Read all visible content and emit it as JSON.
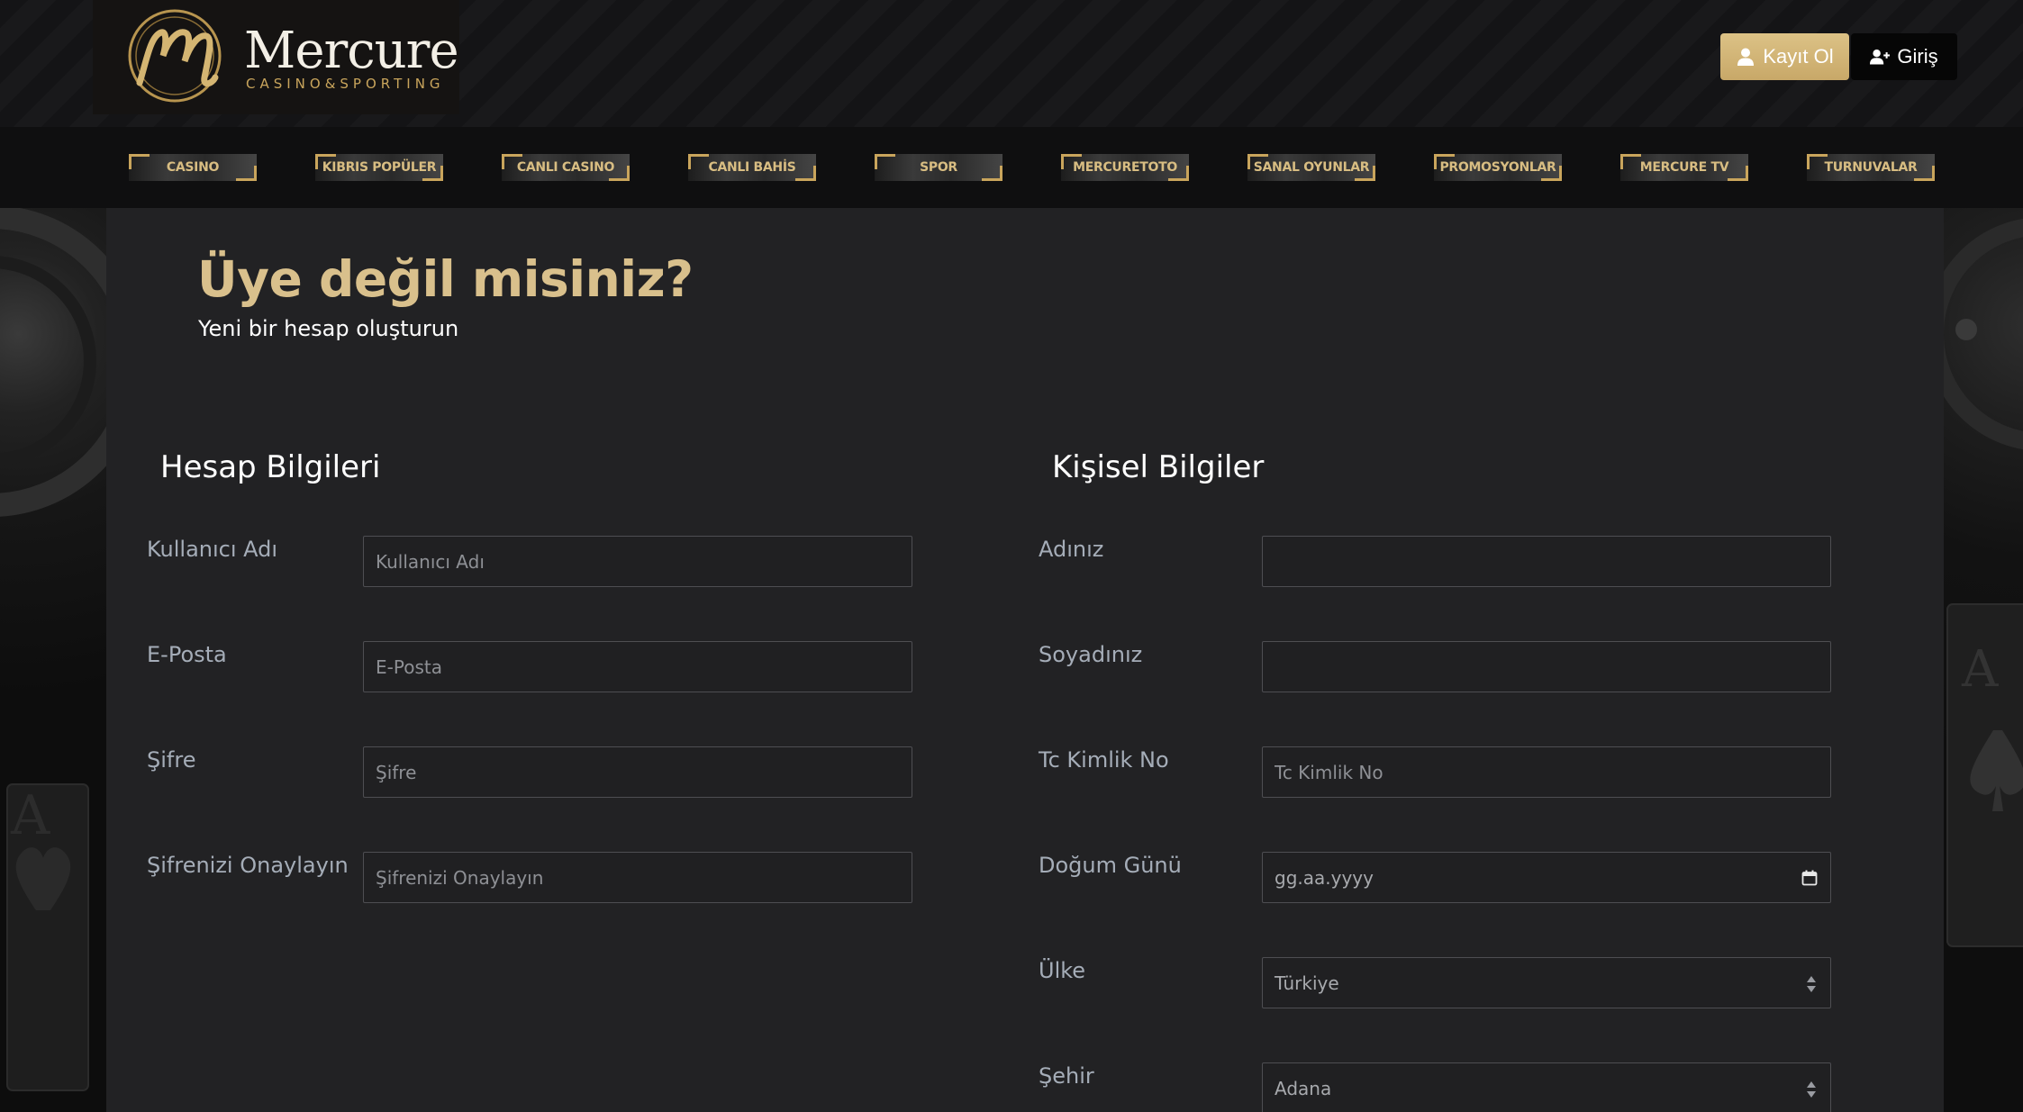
{
  "header": {
    "logo_text": "Mercure",
    "logo_subtext": "CASINO&SPORTING",
    "register_label": "Kayıt Ol",
    "login_label": "Giriş"
  },
  "nav": {
    "items": [
      {
        "label": "CASINO"
      },
      {
        "label": "KIBRIS POPÜLER"
      },
      {
        "label": "CANLI CASINO"
      },
      {
        "label": "CANLI BAHİS"
      },
      {
        "label": "SPOR"
      },
      {
        "label": "MERCURETOTO"
      },
      {
        "label": "SANAL OYUNLAR"
      },
      {
        "label": "PROMOSYONLAR"
      },
      {
        "label": "MERCURE TV"
      },
      {
        "label": "TURNUVALAR"
      }
    ]
  },
  "page": {
    "title": "Üye değil misiniz?",
    "subtitle": "Yeni bir hesap oluşturun"
  },
  "account": {
    "section_title": "Hesap Bilgileri",
    "fields": [
      {
        "label": "Kullanıcı Adı",
        "placeholder": "Kullanıcı Adı",
        "value": ""
      },
      {
        "label": "E-Posta",
        "placeholder": "E-Posta",
        "value": ""
      },
      {
        "label": "Şifre",
        "placeholder": "Şifre",
        "value": ""
      },
      {
        "label": "Şifrenizi Onaylayın",
        "placeholder": "Şifrenizi Onaylayın",
        "value": ""
      }
    ]
  },
  "personal": {
    "section_title": "Kişisel Bilgiler",
    "fields": [
      {
        "label": "Adınız",
        "placeholder": "",
        "value": ""
      },
      {
        "label": "Soyadınız",
        "placeholder": "",
        "value": ""
      },
      {
        "label": "Tc Kimlik No",
        "placeholder": "Tc Kimlik No",
        "value": ""
      },
      {
        "label": "Doğum Günü",
        "placeholder": "gg.aa.yyyy",
        "value": ""
      }
    ],
    "country": {
      "label": "Ülke",
      "selected": "Türkiye"
    },
    "city": {
      "label": "Şehir",
      "selected": "Adana"
    }
  },
  "colors": {
    "accent_gold": "#d9c08c",
    "panel_bg": "#222224",
    "register_button": "#d4b877"
  },
  "icons": {
    "register": "user-icon",
    "login": "user-plus-icon",
    "birthday": "calendar-icon",
    "select": "updown-arrows-icon"
  }
}
